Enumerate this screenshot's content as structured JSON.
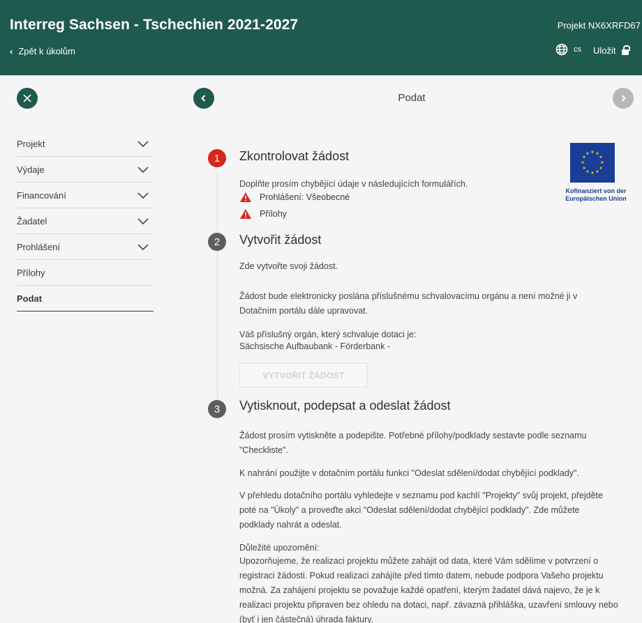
{
  "header": {
    "app_title": "Interreg Sachsen - Tschechien 2021-2027",
    "project_id": "Projekt NX6XRFD67",
    "back_label": "Zpět k úkolům",
    "language": "cs",
    "save_label": "Uložit"
  },
  "page": {
    "heading": "Podat"
  },
  "sidebar": {
    "items": [
      {
        "label": "Projekt",
        "expandable": true
      },
      {
        "label": "Výdaje",
        "expandable": true
      },
      {
        "label": "Financování",
        "expandable": true
      },
      {
        "label": "Žadatel",
        "expandable": true
      },
      {
        "label": "Prohlášení",
        "expandable": true
      },
      {
        "label": "Přílohy",
        "expandable": false
      },
      {
        "label": "Podat",
        "expandable": false,
        "active": true
      }
    ]
  },
  "steps": [
    {
      "number": "1",
      "title": "Zkontrolovat žádost",
      "status_color": "#d5271d",
      "text": "Doplňte prosím chybějící údaje v následujících formulářích.",
      "warnings": [
        "Prohlášení: Všeobecné",
        "Přílohy"
      ]
    },
    {
      "number": "2",
      "title": "Vytvořit žádost",
      "text1": "Zde vytvořte svoji žádost.",
      "text2": "Žádost bude elektronicky poslána příslušnému schvalovacímu orgánu a není možné ji v Dotačním portálu dále upravovat.",
      "text3": "Váš příslušný orgán, který schvaluje dotaci je:",
      "text4": "Sächsische Aufbaubank - Förderbank -",
      "button_label": "VYTVOŘIT ŽÁDOST"
    },
    {
      "number": "3",
      "title": "Vytisknout, podepsat a odeslat žádost",
      "p1": "Žádost prosím vytiskněte a podepište. Potřebné přílohy/podklady sestavte podle seznamu \"Checkliste\".",
      "p2": "K nahrání použijte v dotačním portálu funkci \"Odeslat sdělení/dodat chybějící podklady\".",
      "p3": "V přehledu dotačního portálu vyhledejte v seznamu pod kachlí \"Projekty\" svůj projekt, přejděte poté na \"Úkoly\" a proveďte akci \"Odeslat sdělení/dodat chybějící podklady\". Zde můžete podklady nahrát a odeslat.",
      "p4_title": "Důležité upozornění:",
      "p4": "Upozorňujeme, že realizaci projektu můžete zahájit od data, které Vám sdělíme v potvrzení o registraci žádosti. Pokud realizaci zahájíte před tímto datem, nebude podpora Vašeho projektu možná. Za zahájení projektu se považuje každé opatření, kterým žadatel dává najevo, že je k realizaci projektu připraven bez ohledu na dotaci, např. závazná přihláška, uzavření smlouvy nebo (byť i jen částečná) úhrada faktury."
    }
  ],
  "eu_logo": {
    "line1": "Kofinanziert von der",
    "line2": "Europäischen Union",
    "color": "#1a3e97"
  },
  "colors": {
    "brand": "#1f5a4e",
    "warning": "#d5271d"
  }
}
